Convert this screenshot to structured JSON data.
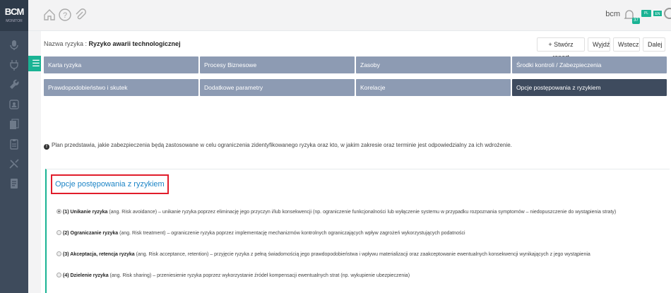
{
  "app": {
    "logo": "BCM",
    "logo_sub": "MONITOR",
    "user_name": "bcm",
    "notifications_count": "37",
    "lang_pl": "PL",
    "lang_en": "EN"
  },
  "header": {
    "risk_name_label": "Nazwa ryzyka :",
    "risk_name_value": "Ryzyko awarii technologicznej",
    "buttons": {
      "create_report": "+ Stwórz raport",
      "exit": "Wyjdź",
      "back": "Wstecz",
      "next": "Dalej"
    }
  },
  "tabs": [
    {
      "label": "Karta ryzyka",
      "active": false
    },
    {
      "label": "Procesy Biznesowe",
      "active": false
    },
    {
      "label": "Zasoby",
      "active": false
    },
    {
      "label": "Środki kontroli / Zabezpieczenia",
      "active": false
    },
    {
      "label": "Prawdopodobieństwo i skutek",
      "active": false
    },
    {
      "label": "Dodatkowe parametry",
      "active": false
    },
    {
      "label": "Korelacje",
      "active": false
    },
    {
      "label": "Opcje postępowania z ryzykiem",
      "active": true
    }
  ],
  "info_text": "Plan przedstawia, jakie zabezpieczenia będą zastosowane w celu ograniczenia zidentyfikowanego ryzyka oraz kto, w jakim zakresie oraz terminie jest odpowiedzialny za ich wdrożenie.",
  "section": {
    "title": "Opcje postępowania z ryzykiem",
    "options": [
      {
        "bold": "(1) Unikanie ryzyka",
        "text": " (ang. Risk avoidance) – unikanie ryzyka poprzez eliminację jego przyczyn i/lub konsekwencji (np. ograniczenie funkcjonalności lub wyłączenie systemu w przypadku rozpoznania symptomów – niedopuszczenie do wystąpienia straty)",
        "selected": true
      },
      {
        "bold": "(2) Ograniczanie ryzyka",
        "text": " (ang. Risk treatment) – ograniczenie ryzyka poprzez implementację mechanizmów kontrolnych ograniczających wpływ zagrożeń wykorzystujących podatności",
        "selected": false
      },
      {
        "bold": "(3) Akceptacja, retencja ryzyka",
        "text": " (ang. Risk acceptance, retention) – przyjęcie ryzyka z pełną świadomością jego prawdopodobieństwa i wpływu materializacji oraz zaakceptowanie ewentualnych konsekwencji wynikających z jego wystąpienia",
        "selected": false
      },
      {
        "bold": "(4) Dzielenie ryzyka",
        "text": " (ang. Risk sharing) – przeniesienie ryzyka poprzez wykorzystanie źródeł kompensacji ewentualnych strat (np. wykupienie ubezpieczenia)",
        "selected": false
      }
    ]
  }
}
